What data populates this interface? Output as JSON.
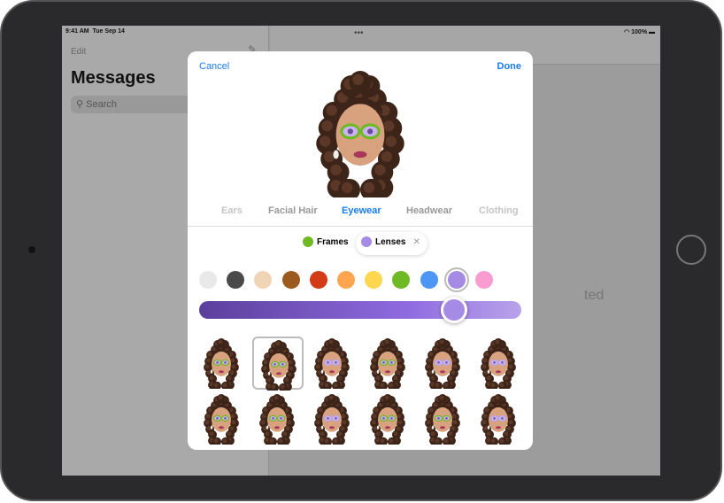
{
  "status": {
    "time": "9:41 AM",
    "date": "Tue Sep 14",
    "battery": "100%"
  },
  "sidebar": {
    "edit": "Edit",
    "title": "Messages",
    "search_placeholder": "Search"
  },
  "background_text": "ted",
  "modal": {
    "cancel": "Cancel",
    "done": "Done",
    "tabs": [
      {
        "label": "Ears",
        "state": "faded"
      },
      {
        "label": "Facial Hair"
      },
      {
        "label": "Eyewear",
        "active": true
      },
      {
        "label": "Headwear"
      },
      {
        "label": "Clothing",
        "state": "faded"
      }
    ],
    "chips": [
      {
        "label": "Frames",
        "color": "#6fba24"
      },
      {
        "label": "Lenses",
        "color": "#a58ae6",
        "selected": true
      }
    ],
    "swatches": [
      "#e9e9e9",
      "#4a4a4a",
      "#efd5b5",
      "#9c5a1e",
      "#d33a16",
      "#ffa54f",
      "#ffd64f",
      "#6fba24",
      "#4e96f5",
      "#a58ae6",
      "#f99ccf"
    ],
    "selected_swatch": 9,
    "slider_value": 0.79,
    "styles": [
      {
        "frame": "#6fba24"
      },
      {
        "frame": "#6fba24",
        "selected": true
      },
      {
        "frame": "#b9a3ea"
      },
      {
        "frame": "#6fba24"
      },
      {
        "frame": "#b9a3ea"
      },
      {
        "frame": "#b9a3ea"
      },
      {
        "frame": "#6fba24"
      },
      {
        "frame": "#6fba24"
      },
      {
        "frame": "#b9a3ea"
      },
      {
        "frame": "#6fba24"
      },
      {
        "frame": "#6fba24"
      },
      {
        "frame": "#b9a3ea"
      }
    ]
  }
}
